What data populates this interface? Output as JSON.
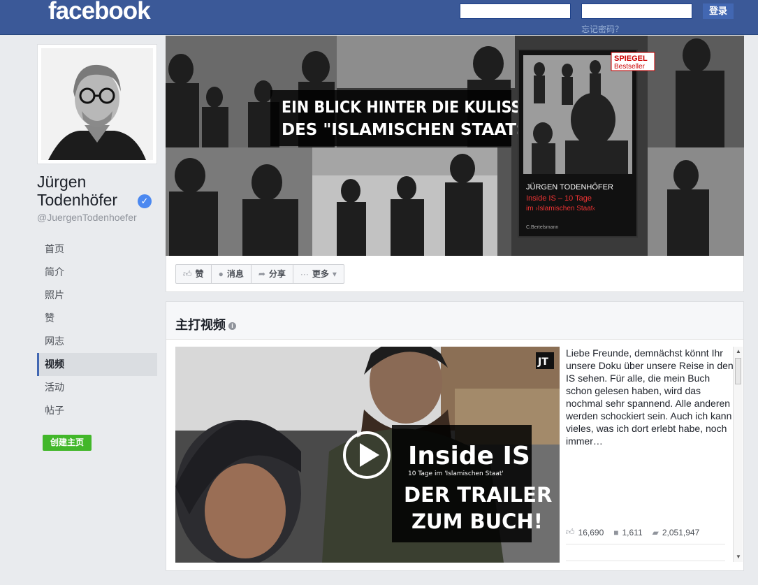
{
  "header": {
    "logo": "facebook",
    "email_placeholder": "",
    "password_placeholder": "",
    "login_label": "登录",
    "forgot_label": "忘记密码？"
  },
  "profile": {
    "name": "Jürgen Todenhöfer",
    "handle": "@JuergenTodenhoefer",
    "verified": true
  },
  "nav": {
    "items": [
      {
        "label": "首页"
      },
      {
        "label": "简介"
      },
      {
        "label": "照片"
      },
      {
        "label": "赞"
      },
      {
        "label": "网志"
      },
      {
        "label": "视频",
        "active": true
      },
      {
        "label": "活动"
      },
      {
        "label": "帖子"
      }
    ],
    "create_page_label": "创建主页"
  },
  "cover": {
    "headline_1": "EIN BLICK HINTER DIE KULISSEN",
    "headline_2": "DES \"ISLAMISCHEN STAATS\"",
    "book_badge_1": "SPIEGEL",
    "book_badge_2": "Bestseller",
    "book_author": "JÜRGEN TODENHÖFER",
    "book_title": "Inside IS – 10 Tage",
    "book_subtitle": "im ›Islamischen Staat‹",
    "book_publisher": "C.Bertelsmann"
  },
  "actions": {
    "like": "赞",
    "message": "消息",
    "share": "分享",
    "more": "更多"
  },
  "featured_video": {
    "section_title": "主打视频",
    "overlay_title": "Inside IS",
    "overlay_subtitle": "10 Tage im 'Islamischen Staat'",
    "overlay_line_1": "DER TRAILER",
    "overlay_line_2": "ZUM BUCH!",
    "channel_badge": "JT",
    "description": "Liebe Freunde, demnächst könnt Ihr unsere Doku über unsere Reise in den IS sehen. Für alle, die mein Buch schon gelesen haben, wird das nochmal sehr spannend. Alle anderen werden schockiert sein. Auch ich kann vieles, was ich dort erlebt habe, noch immer…",
    "likes": "16,690",
    "comments": "1,611",
    "views": "2,051,947"
  },
  "colors": {
    "brand_blue": "#3b5998",
    "background": "#e9ebee",
    "create_green": "#42b72a",
    "verified_blue": "#4b88f0"
  },
  "icons": [
    "like-icon",
    "message-icon",
    "share-icon",
    "more-icon",
    "verified-icon",
    "play-icon",
    "info-icon",
    "comment-icon",
    "video-icon"
  ]
}
